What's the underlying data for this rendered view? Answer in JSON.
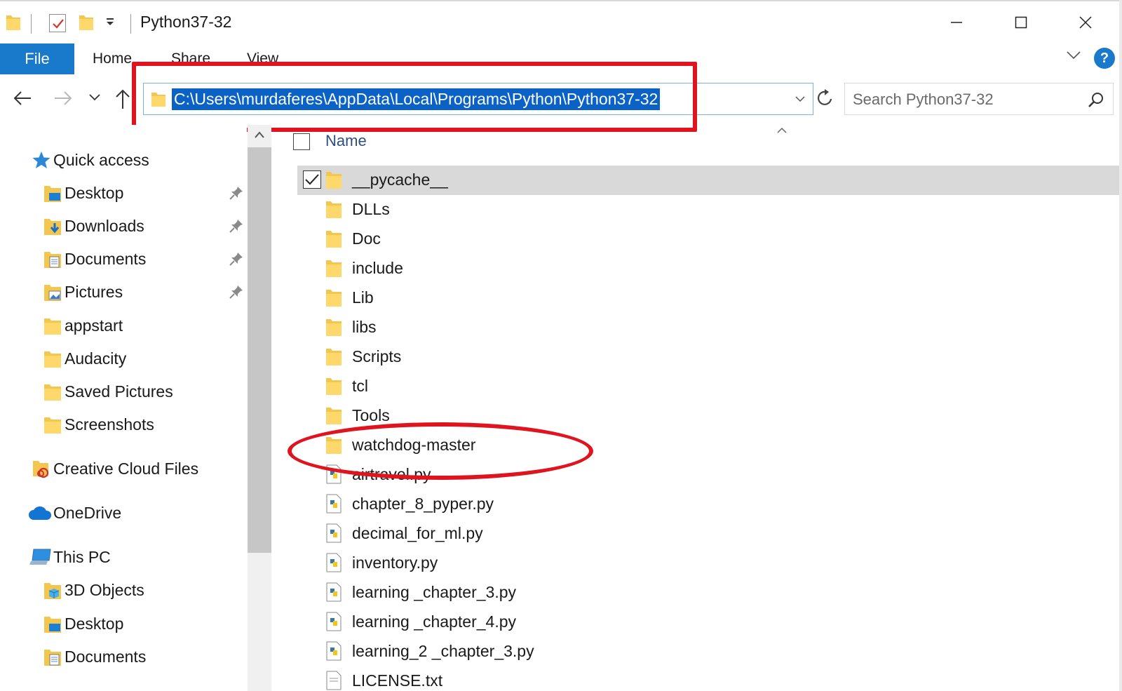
{
  "window": {
    "title": "Python37-32",
    "controls": {
      "minimize": "minimize",
      "maximize": "maximize",
      "close": "close"
    }
  },
  "ribbon": {
    "tabs": [
      {
        "label": "File"
      },
      {
        "label": "Home"
      },
      {
        "label": "Share"
      },
      {
        "label": "View"
      }
    ],
    "help": "?"
  },
  "navbar": {
    "address": "C:\\Users\\murdaferes\\AppData\\Local\\Programs\\Python\\Python37-32",
    "search_placeholder": "Search Python37-32"
  },
  "sidebar": {
    "items": [
      {
        "label": "Quick access",
        "icon": "star-icon",
        "pinned": false
      },
      {
        "label": "Desktop",
        "icon": "desktop-folder-icon",
        "pinned": true
      },
      {
        "label": "Downloads",
        "icon": "downloads-folder-icon",
        "pinned": true
      },
      {
        "label": "Documents",
        "icon": "documents-folder-icon",
        "pinned": true
      },
      {
        "label": "Pictures",
        "icon": "pictures-folder-icon",
        "pinned": true
      },
      {
        "label": "appstart",
        "icon": "folder-icon",
        "pinned": false
      },
      {
        "label": "Audacity",
        "icon": "folder-icon",
        "pinned": false
      },
      {
        "label": "Saved Pictures",
        "icon": "folder-icon",
        "pinned": false
      },
      {
        "label": "Screenshots",
        "icon": "folder-icon",
        "pinned": false
      },
      {
        "label": "Creative Cloud Files",
        "icon": "creative-cloud-icon",
        "pinned": false
      },
      {
        "label": "OneDrive",
        "icon": "cloud-icon",
        "pinned": false
      },
      {
        "label": "This PC",
        "icon": "computer-icon",
        "pinned": false
      },
      {
        "label": "3D Objects",
        "icon": "3d-objects-icon",
        "pinned": false
      },
      {
        "label": "Desktop",
        "icon": "desktop-folder-icon",
        "pinned": false
      },
      {
        "label": "Documents",
        "icon": "documents-folder-icon",
        "pinned": false
      }
    ]
  },
  "filelist": {
    "column_name": "Name",
    "rows": [
      {
        "name": "__pycache__",
        "type": "folder",
        "selected": true
      },
      {
        "name": "DLLs",
        "type": "folder"
      },
      {
        "name": "Doc",
        "type": "folder"
      },
      {
        "name": "include",
        "type": "folder"
      },
      {
        "name": "Lib",
        "type": "folder"
      },
      {
        "name": "libs",
        "type": "folder"
      },
      {
        "name": "Scripts",
        "type": "folder"
      },
      {
        "name": "tcl",
        "type": "folder"
      },
      {
        "name": "Tools",
        "type": "folder"
      },
      {
        "name": "watchdog-master",
        "type": "folder",
        "highlighted": true
      },
      {
        "name": "airtravel.py",
        "type": "python"
      },
      {
        "name": "chapter_8_pyper.py",
        "type": "python"
      },
      {
        "name": "decimal_for_ml.py",
        "type": "python"
      },
      {
        "name": "inventory.py",
        "type": "python"
      },
      {
        "name": "learning _chapter_3.py",
        "type": "python"
      },
      {
        "name": "learning _chapter_4.py",
        "type": "python"
      },
      {
        "name": "learning_2 _chapter_3.py",
        "type": "python"
      },
      {
        "name": "LICENSE.txt",
        "type": "text"
      }
    ]
  },
  "colors": {
    "accent": "#1979ca",
    "selection": "#0a62c6",
    "annotation_red": "#e0141e",
    "row_selected": "#d9d9d9"
  }
}
